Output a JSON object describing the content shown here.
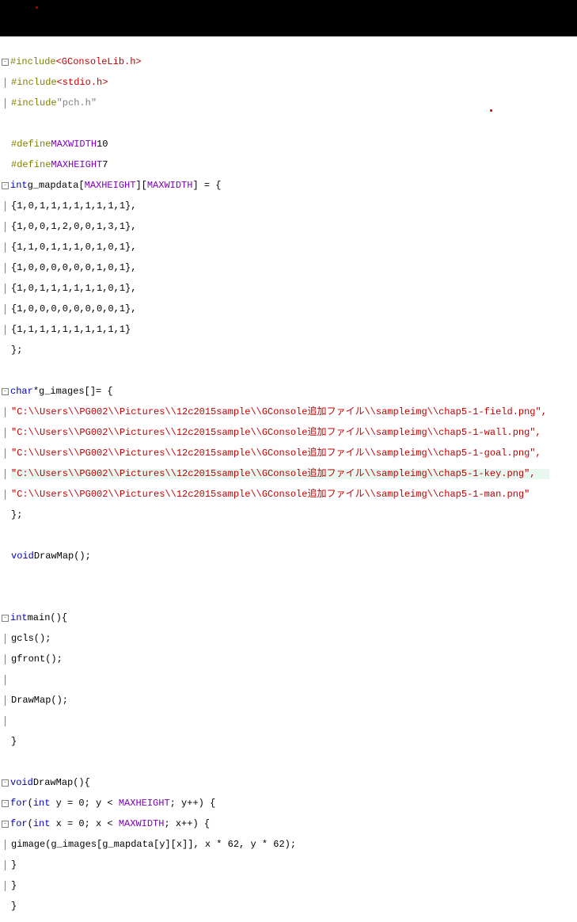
{
  "includes": [
    {
      "directive": "#include",
      "target": "<GConsoleLib.h>"
    },
    {
      "directive": "#include",
      "target": "<stdio.h>"
    },
    {
      "directive": "#include",
      "target": "\"pch.h\""
    }
  ],
  "defines": [
    {
      "directive": "#define",
      "name": "MAXWIDTH",
      "value": "10"
    },
    {
      "directive": "#define",
      "name": "MAXHEIGHT",
      "value": "7"
    }
  ],
  "mapdecl": {
    "type": "int",
    "name": "g_mapdata",
    "dim1": "MAXHEIGHT",
    "dim2": "MAXWIDTH",
    "rows": [
      "{1,0,1,1,1,1,1,1,1,1},",
      "{1,0,0,1,2,0,0,1,3,1},",
      "{1,1,0,1,1,1,0,1,0,1},",
      "{1,0,0,0,0,0,0,1,0,1},",
      "{1,0,1,1,1,1,1,1,0,1},",
      "{1,0,0,0,0,0,0,0,0,1},",
      "{1,1,1,1,1,1,1,1,1,1}"
    ],
    "end": "};"
  },
  "images": {
    "type": "char",
    "name": "*g_images[]",
    "strings": [
      "\"C:\\\\Users\\\\PG002\\\\Pictures\\\\12c2015sample\\\\GConsole追加ファイル\\\\sampleimg\\\\chap5-1-field.png\",",
      "\"C:\\\\Users\\\\PG002\\\\Pictures\\\\12c2015sample\\\\GConsole追加ファイル\\\\sampleimg\\\\chap5-1-wall.png\",",
      "\"C:\\\\Users\\\\PG002\\\\Pictures\\\\12c2015sample\\\\GConsole追加ファイル\\\\sampleimg\\\\chap5-1-goal.png\",",
      "\"C:\\\\Users\\\\PG002\\\\Pictures\\\\12c2015sample\\\\GConsole追加ファイル\\\\sampleimg\\\\chap5-1-key.png\",",
      "\"C:\\\\Users\\\\PG002\\\\Pictures\\\\12c2015sample\\\\GConsole追加ファイル\\\\sampleimg\\\\chap5-1-man.png\""
    ],
    "end": "};"
  },
  "proto": {
    "type": "void",
    "name": "DrawMap",
    "params": "()",
    "end": ";"
  },
  "main": {
    "type": "int",
    "name": "main",
    "params": "()",
    "open": "{",
    "body": [
      "gcls();",
      "gfront();",
      "",
      "DrawMap();",
      ""
    ],
    "close": "}"
  },
  "drawmap": {
    "type": "void",
    "name": "DrawMap",
    "params": "()",
    "open": "{",
    "for_y_kw": "for",
    "for_y_init_type": "int",
    "for_y": "(      y = 0; y <          ; y++) {",
    "for_y_macro": "MAXHEIGHT",
    "for_x_kw": "for",
    "for_x_init_type": "int",
    "for_x": "(      x = 0; x <         ; x++) {",
    "for_x_macro": "MAXWIDTH",
    "gimage": "gimage(g_images[g_mapdata[y][x]], x * 62, y * 62);",
    "inner_close": "}",
    "outer_close": "}",
    "close": "}"
  }
}
